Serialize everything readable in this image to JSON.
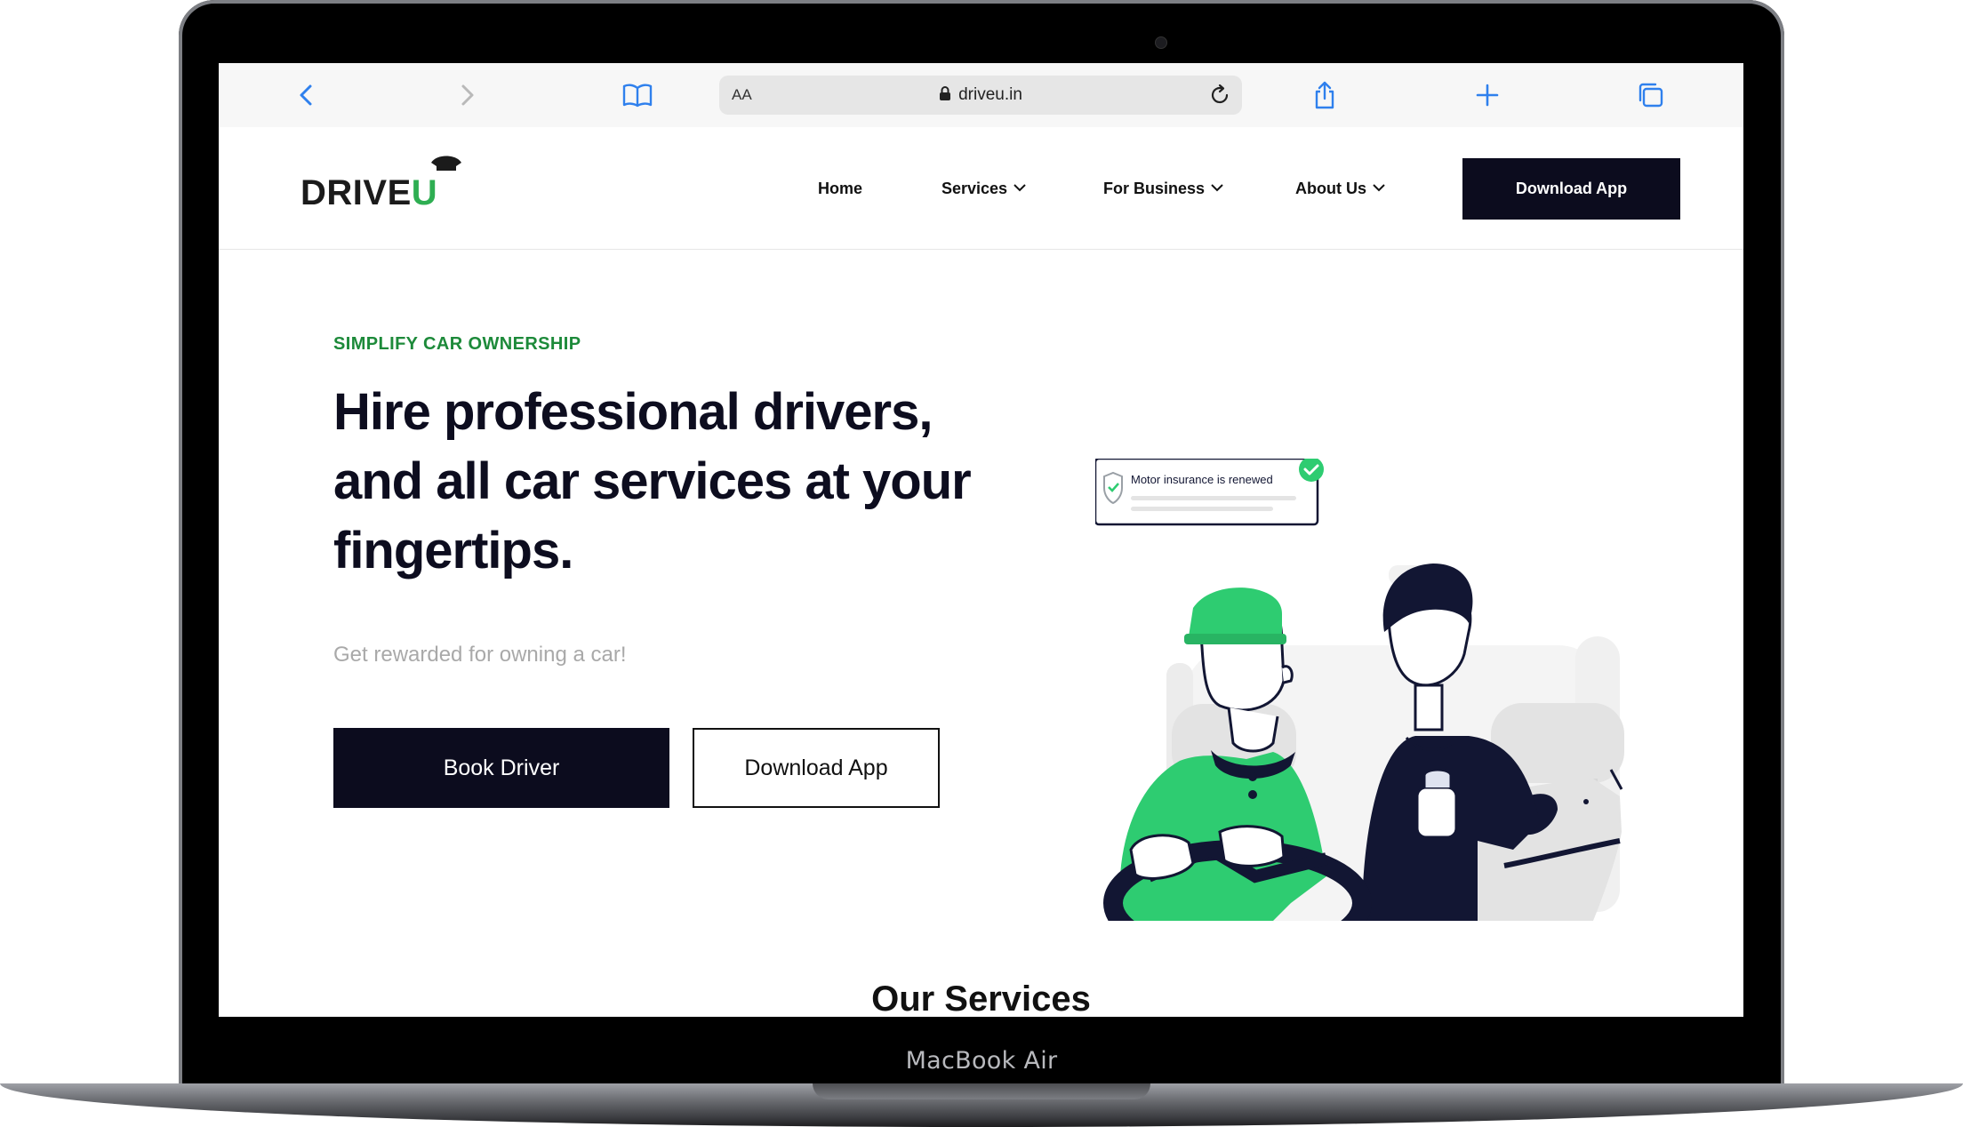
{
  "device": {
    "label": "MacBook Air"
  },
  "browser": {
    "text_size_label": "AA",
    "url": "driveu.in",
    "icons": [
      "back-icon",
      "forward-icon",
      "bookmarks-icon",
      "lock-icon",
      "reload-icon",
      "share-icon",
      "new-tab-icon",
      "tabs-icon"
    ]
  },
  "site": {
    "logo": {
      "text": "DRIVE",
      "accent": "U"
    },
    "nav": [
      {
        "label": "Home",
        "has_dropdown": false
      },
      {
        "label": "Services",
        "has_dropdown": true
      },
      {
        "label": "For Business",
        "has_dropdown": true
      },
      {
        "label": "About Us",
        "has_dropdown": true
      }
    ],
    "header_cta": "Download App"
  },
  "hero": {
    "eyebrow": "SIMPLIFY CAR OWNERSHIP",
    "title_lines": [
      "Hire professional drivers,",
      "and all car services at your",
      "fingertips."
    ],
    "subtitle": "Get rewarded for owning a car!",
    "primary_button": "Book Driver",
    "secondary_button": "Download App",
    "illustration": {
      "notification_text": "Motor insurance is renewed"
    }
  },
  "services": {
    "heading": "Our Services"
  },
  "colors": {
    "brand_dark": "#0c0c1e",
    "brand_green": "#2ecc71",
    "eyebrow_green": "#1d8a3a",
    "muted_text": "#a9a9a9"
  }
}
